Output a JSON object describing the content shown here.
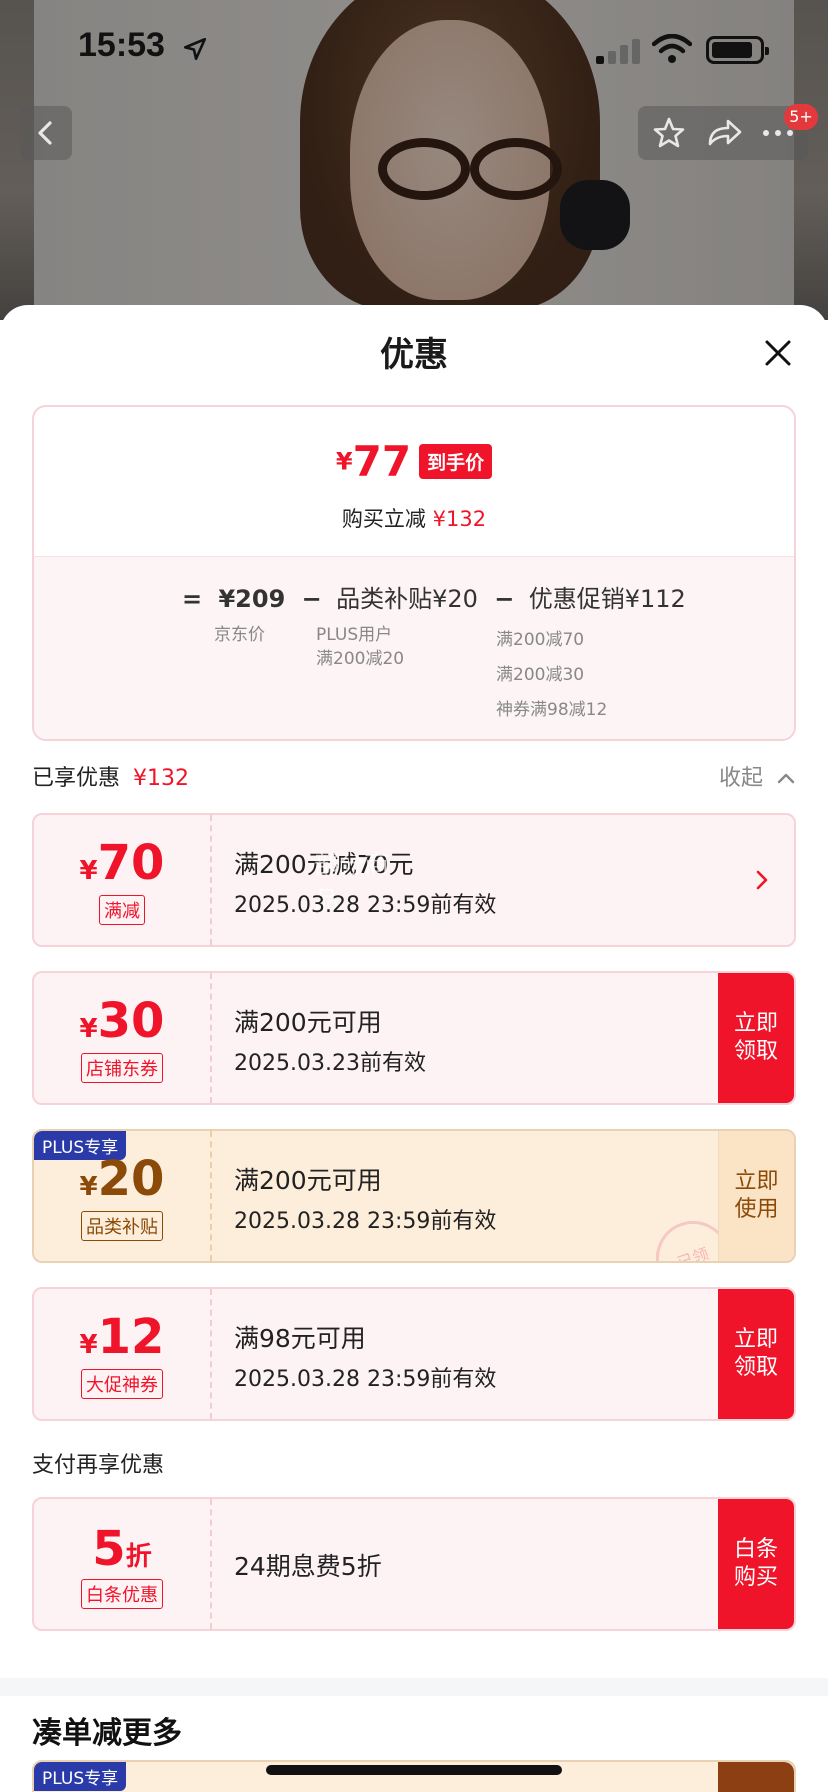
{
  "status_bar": {
    "time": "15:53"
  },
  "header": {
    "cart_badge": "5+"
  },
  "sheet": {
    "title": "优惠",
    "summary": {
      "final_price_symbol": "¥",
      "final_price": "77",
      "final_price_tag": "到手价",
      "instant_label": "购买立减",
      "instant_amount": "¥132",
      "formula": {
        "eq": "=",
        "jd_price": "¥209",
        "minus1": "−",
        "category_subsidy": "品类补贴¥20",
        "minus2": "−",
        "promo": "优惠促销¥112"
      },
      "jd_price_label": "京东价",
      "subsidy_lines": [
        "PLUS用户",
        "满200减20"
      ],
      "promo_lines": [
        "满200减70",
        "满200减30",
        "神券满98减12"
      ]
    },
    "enjoyed_label": "已享优惠",
    "enjoyed_amount": "¥132",
    "collapse_label": "收起",
    "coupons": [
      {
        "symbol": "¥",
        "amount": "70",
        "kind": "满减",
        "line1": "满200元减70元",
        "line2": "2025.03.28 23:59前有效",
        "cta": "",
        "overlay_text": "部分商品"
      },
      {
        "symbol": "¥",
        "amount": "30",
        "kind": "店铺东券",
        "line1": "满200元可用",
        "line2": "2025.03.23前有效",
        "cta": "立即领取"
      },
      {
        "badge": "PLUS专享",
        "symbol": "¥",
        "amount": "20",
        "kind": "品类补贴",
        "line1": "满200元可用",
        "line2": "2025.03.28 23:59前有效",
        "cta": "立即使用",
        "stamp": "已领"
      },
      {
        "symbol": "¥",
        "amount": "12",
        "kind": "大促神券",
        "line1": "满98元可用",
        "line2": "2025.03.28 23:59前有效",
        "cta": "立即领取"
      }
    ],
    "pay_section_label": "支付再享优惠",
    "pay_coupon": {
      "amount": "5",
      "unit": "折",
      "kind": "白条优惠",
      "line1": "24期息费5折",
      "cta": "白条购买"
    },
    "more_title": "凑单减更多",
    "more_badge": "PLUS专享"
  },
  "colors": {
    "accent_red": "#f0142a",
    "gold_text": "#8b4a08",
    "plus_blue": "#2a3aa8"
  },
  "icons": [
    "location-arrow-icon",
    "signal-icon",
    "wifi-icon",
    "battery-icon",
    "back-icon",
    "star-icon",
    "share-icon",
    "more-icon",
    "close-icon",
    "chevron-up-icon",
    "chevron-right-icon"
  ]
}
